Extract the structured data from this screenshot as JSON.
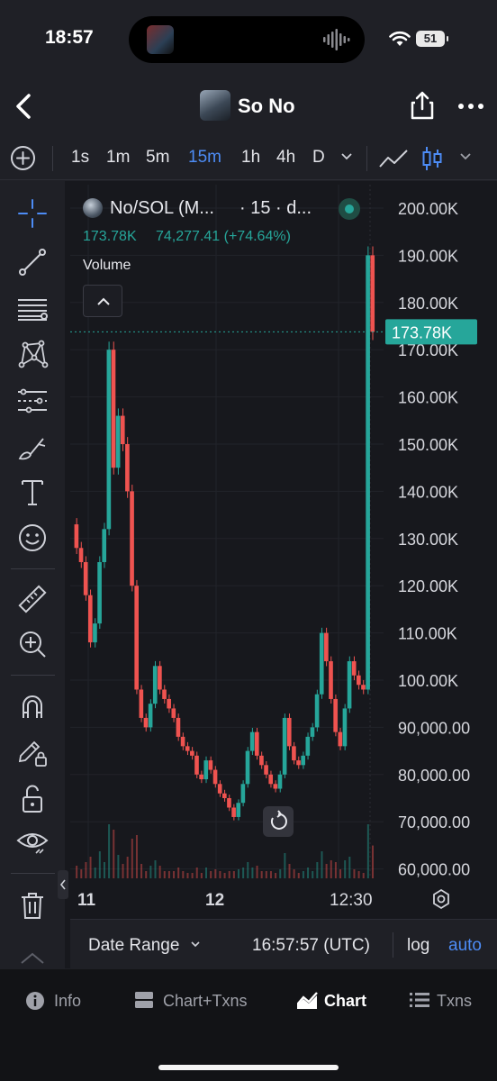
{
  "status_bar": {
    "time": "18:57",
    "battery": "51"
  },
  "header": {
    "title": "So No"
  },
  "toolbar": {
    "timeframes": [
      {
        "label": "1s",
        "active": false
      },
      {
        "label": "1m",
        "active": false
      },
      {
        "label": "5m",
        "active": false
      },
      {
        "label": "15m",
        "active": true
      },
      {
        "label": "1h",
        "active": false
      },
      {
        "label": "4h",
        "active": false
      },
      {
        "label": "D",
        "active": false
      }
    ]
  },
  "legend": {
    "symbol": "No/SOL (M...",
    "interval": "· 15 · d...",
    "price_last": "173.78K",
    "change": "74,277.41 (+74.64%)",
    "volume_label": "Volume"
  },
  "price_axis": {
    "ticks": [
      "200.00K",
      "190.00K",
      "180.00K",
      "170.00K",
      "160.00K",
      "150.00K",
      "140.00K",
      "130.00K",
      "120.00K",
      "110.00K",
      "100.00K",
      "90,000.00",
      "80,000.00",
      "70,000.00",
      "60,000.00"
    ],
    "current_label": "173.78K"
  },
  "time_axis": {
    "ticks": [
      "11",
      "12",
      "12:30"
    ]
  },
  "bottom_bar": {
    "date_range": "Date Range",
    "clock": "16:57:57 (UTC)",
    "log": "log",
    "auto": "auto"
  },
  "tabs": [
    {
      "label": "Info",
      "icon": "info-icon",
      "active": false
    },
    {
      "label": "Chart+Txns",
      "icon": "chart-txns-icon",
      "active": false
    },
    {
      "label": "Chart",
      "icon": "chart-icon",
      "active": true
    },
    {
      "label": "Txns",
      "icon": "list-icon",
      "active": false
    }
  ],
  "colors": {
    "up": "#26a69a",
    "down": "#ef5350",
    "accent": "#4d8cf5",
    "background": "#17181d"
  },
  "chart_data": {
    "type": "candlestick",
    "title": "No/SOL",
    "interval": "15",
    "ylim": [
      60000,
      200000
    ],
    "x_ticks": [
      "11",
      "12",
      "12:30"
    ],
    "last_price": 173780,
    "close_path": [
      133000,
      128000,
      125000,
      118000,
      108000,
      112000,
      125000,
      132000,
      170000,
      145000,
      156000,
      150000,
      140000,
      120000,
      98000,
      92000,
      90000,
      95000,
      103000,
      98000,
      96000,
      94000,
      92000,
      88000,
      86000,
      85000,
      84000,
      80000,
      79000,
      83000,
      81000,
      78000,
      76000,
      75000,
      73000,
      71000,
      74000,
      78000,
      85000,
      89000,
      84000,
      82000,
      80000,
      78000,
      77000,
      80000,
      92000,
      86000,
      83000,
      82000,
      84000,
      88000,
      90000,
      97000,
      110000,
      104000,
      96000,
      89000,
      86000,
      94000,
      104000,
      101000,
      99000,
      98000,
      190000,
      173780
    ]
  }
}
